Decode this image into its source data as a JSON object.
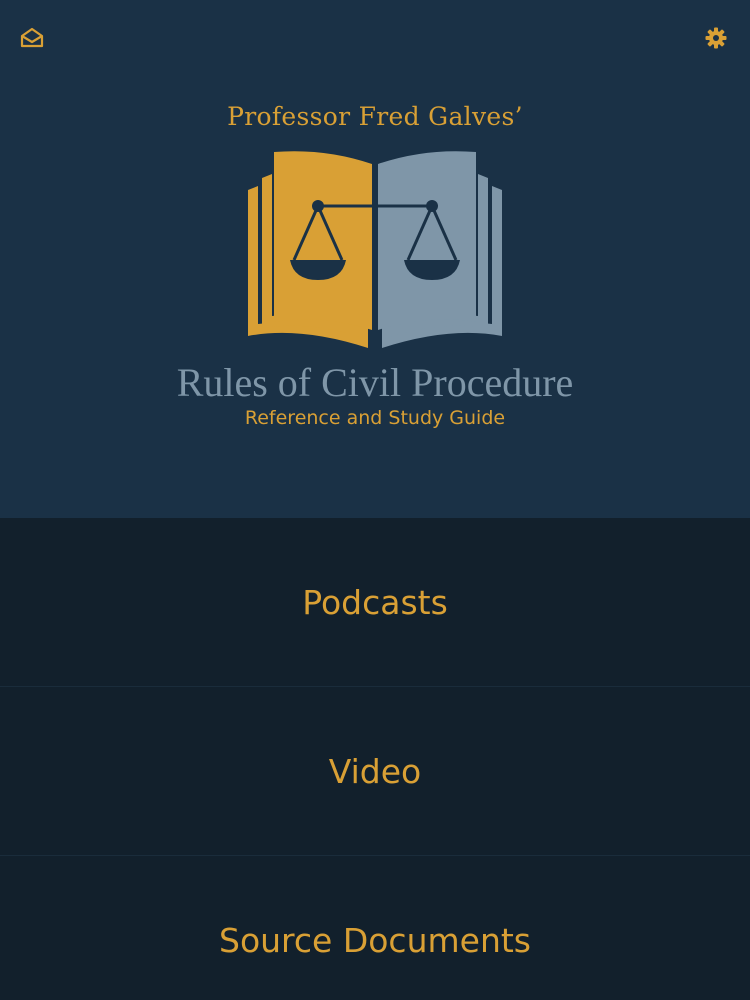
{
  "header": {
    "mail_icon": "mail-icon",
    "settings_icon": "gear-icon"
  },
  "logo": {
    "author": "Professor Fred Galves’",
    "title": "Rules of Civil Procedure",
    "subtitle": "Reference and Study Guide",
    "colors": {
      "gold": "#d9a035",
      "slate": "#7f96a8",
      "background": "#1a3146"
    }
  },
  "menu": {
    "items": [
      {
        "label": "Podcasts"
      },
      {
        "label": "Video"
      },
      {
        "label": "Source Documents"
      }
    ]
  }
}
